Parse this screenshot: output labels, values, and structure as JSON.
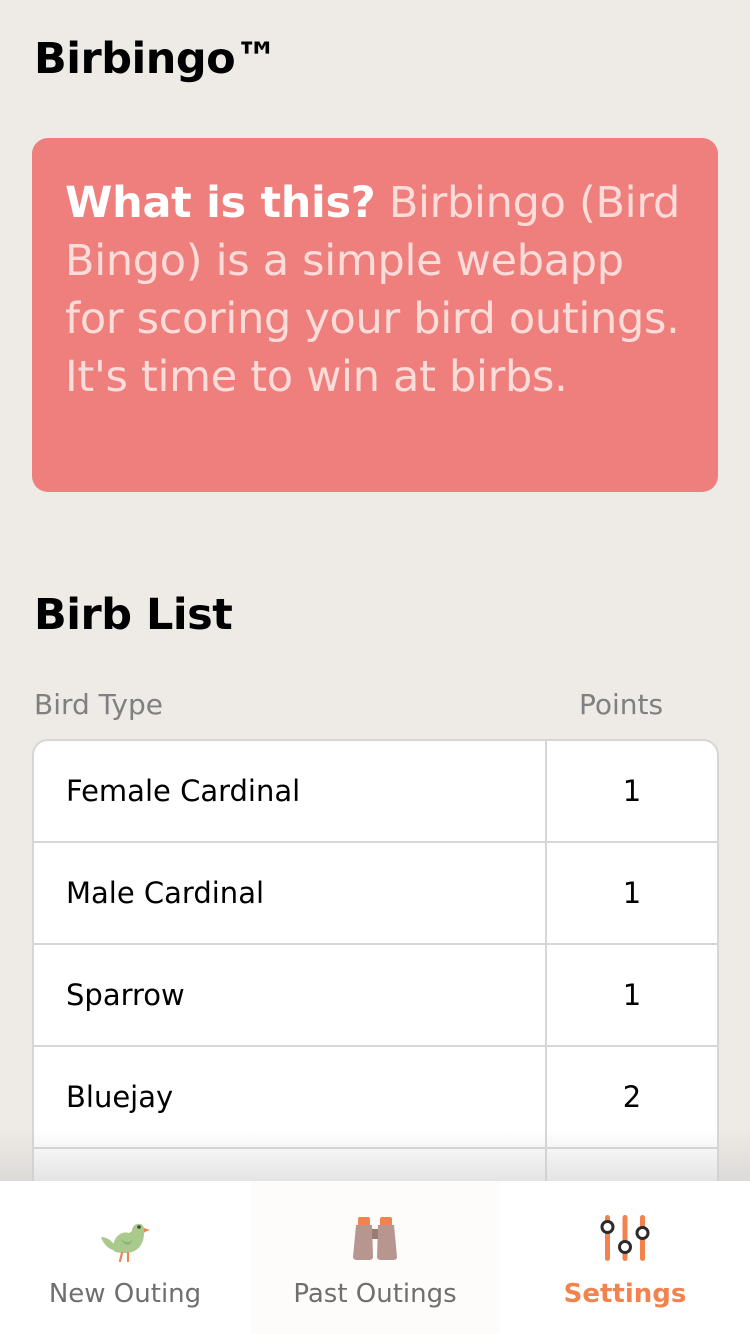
{
  "app": {
    "title": "Birbingo™"
  },
  "intro": {
    "question": "What is this?",
    "body": "Birbingo (Bird Bingo) is a simple webapp for scoring your bird outings. It's time to win at birbs."
  },
  "birb_list": {
    "title": "Birb List",
    "columns": {
      "bird_type": "Bird Type",
      "points": "Points"
    },
    "rows": [
      {
        "name": "Female Cardinal",
        "points": "1"
      },
      {
        "name": "Male Cardinal",
        "points": "1"
      },
      {
        "name": "Sparrow",
        "points": "1"
      },
      {
        "name": "Bluejay",
        "points": "2"
      },
      {
        "name": "",
        "points": ""
      }
    ]
  },
  "nav": {
    "items": [
      {
        "label": "New Outing",
        "icon": "bird-icon",
        "active": false
      },
      {
        "label": "Past Outings",
        "icon": "binoculars-icon",
        "active": false
      },
      {
        "label": "Settings",
        "icon": "sliders-icon",
        "active": true
      }
    ]
  },
  "colors": {
    "background": "#eeeae5",
    "intro_card": "#ee7f7d",
    "accent": "#f2834f"
  }
}
